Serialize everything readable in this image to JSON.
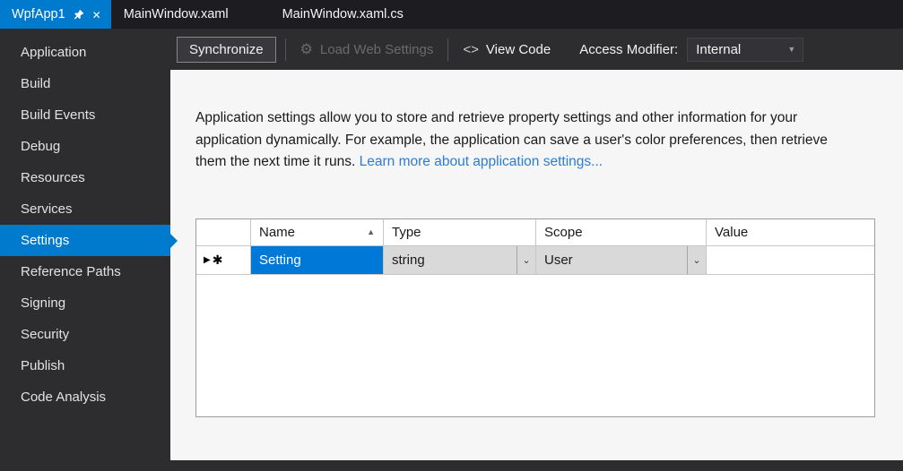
{
  "tabs": {
    "items": [
      {
        "label": "WpfApp1"
      },
      {
        "label": "MainWindow.xaml"
      },
      {
        "label": "MainWindow.xaml.cs"
      }
    ],
    "active": "WpfApp1"
  },
  "sidebar": {
    "items": [
      {
        "label": "Application"
      },
      {
        "label": "Build"
      },
      {
        "label": "Build Events"
      },
      {
        "label": "Debug"
      },
      {
        "label": "Resources"
      },
      {
        "label": "Services"
      },
      {
        "label": "Settings"
      },
      {
        "label": "Reference Paths"
      },
      {
        "label": "Signing"
      },
      {
        "label": "Security"
      },
      {
        "label": "Publish"
      },
      {
        "label": "Code Analysis"
      }
    ],
    "selected": "Settings"
  },
  "toolbar": {
    "synchronize_label": "Synchronize",
    "load_web_settings_label": "Load Web Settings",
    "view_code_label": "View Code",
    "access_modifier_label": "Access Modifier:",
    "access_modifier_value": "Internal"
  },
  "description": {
    "text": "Application settings allow you to store and retrieve property settings and other information for your application dynamically. For example, the application can save a user's color preferences, then retrieve them the next time it runs.  ",
    "link_text": "Learn more about application settings..."
  },
  "grid": {
    "columns": [
      {
        "label": "Name"
      },
      {
        "label": "Type"
      },
      {
        "label": "Scope"
      },
      {
        "label": "Value"
      }
    ],
    "sort": {
      "column": "Name",
      "direction": "ascending"
    },
    "rows": [
      {
        "name": "Setting",
        "type": "string",
        "scope": "User",
        "value": ""
      }
    ]
  },
  "icons": {
    "close": "✕",
    "code": "<>",
    "gear": "⚙",
    "dropdown_arrow": "▼",
    "cell_dropdown": "⌄",
    "sort_ascending": "▲",
    "current_row": "▶",
    "new_row": "✱"
  },
  "colors": {
    "accent": "#007acc",
    "selection": "#0078d7",
    "link": "#2b7cd3"
  }
}
